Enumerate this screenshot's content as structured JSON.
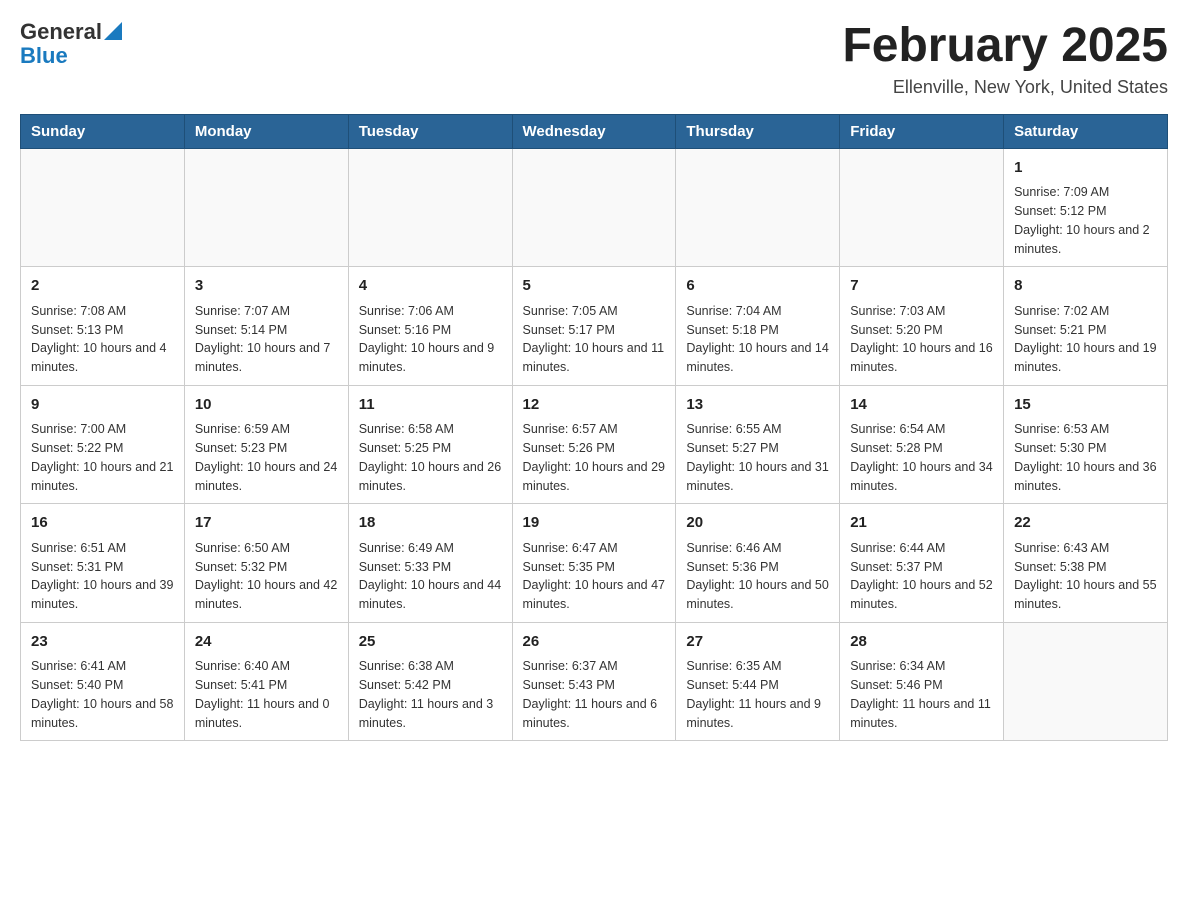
{
  "logo": {
    "general": "General",
    "blue": "Blue"
  },
  "header": {
    "title": "February 2025",
    "location": "Ellenville, New York, United States"
  },
  "weekdays": [
    "Sunday",
    "Monday",
    "Tuesday",
    "Wednesday",
    "Thursday",
    "Friday",
    "Saturday"
  ],
  "weeks": [
    [
      {
        "day": "",
        "sunrise": "",
        "sunset": "",
        "daylight": ""
      },
      {
        "day": "",
        "sunrise": "",
        "sunset": "",
        "daylight": ""
      },
      {
        "day": "",
        "sunrise": "",
        "sunset": "",
        "daylight": ""
      },
      {
        "day": "",
        "sunrise": "",
        "sunset": "",
        "daylight": ""
      },
      {
        "day": "",
        "sunrise": "",
        "sunset": "",
        "daylight": ""
      },
      {
        "day": "",
        "sunrise": "",
        "sunset": "",
        "daylight": ""
      },
      {
        "day": "1",
        "sunrise": "Sunrise: 7:09 AM",
        "sunset": "Sunset: 5:12 PM",
        "daylight": "Daylight: 10 hours and 2 minutes."
      }
    ],
    [
      {
        "day": "2",
        "sunrise": "Sunrise: 7:08 AM",
        "sunset": "Sunset: 5:13 PM",
        "daylight": "Daylight: 10 hours and 4 minutes."
      },
      {
        "day": "3",
        "sunrise": "Sunrise: 7:07 AM",
        "sunset": "Sunset: 5:14 PM",
        "daylight": "Daylight: 10 hours and 7 minutes."
      },
      {
        "day": "4",
        "sunrise": "Sunrise: 7:06 AM",
        "sunset": "Sunset: 5:16 PM",
        "daylight": "Daylight: 10 hours and 9 minutes."
      },
      {
        "day": "5",
        "sunrise": "Sunrise: 7:05 AM",
        "sunset": "Sunset: 5:17 PM",
        "daylight": "Daylight: 10 hours and 11 minutes."
      },
      {
        "day": "6",
        "sunrise": "Sunrise: 7:04 AM",
        "sunset": "Sunset: 5:18 PM",
        "daylight": "Daylight: 10 hours and 14 minutes."
      },
      {
        "day": "7",
        "sunrise": "Sunrise: 7:03 AM",
        "sunset": "Sunset: 5:20 PM",
        "daylight": "Daylight: 10 hours and 16 minutes."
      },
      {
        "day": "8",
        "sunrise": "Sunrise: 7:02 AM",
        "sunset": "Sunset: 5:21 PM",
        "daylight": "Daylight: 10 hours and 19 minutes."
      }
    ],
    [
      {
        "day": "9",
        "sunrise": "Sunrise: 7:00 AM",
        "sunset": "Sunset: 5:22 PM",
        "daylight": "Daylight: 10 hours and 21 minutes."
      },
      {
        "day": "10",
        "sunrise": "Sunrise: 6:59 AM",
        "sunset": "Sunset: 5:23 PM",
        "daylight": "Daylight: 10 hours and 24 minutes."
      },
      {
        "day": "11",
        "sunrise": "Sunrise: 6:58 AM",
        "sunset": "Sunset: 5:25 PM",
        "daylight": "Daylight: 10 hours and 26 minutes."
      },
      {
        "day": "12",
        "sunrise": "Sunrise: 6:57 AM",
        "sunset": "Sunset: 5:26 PM",
        "daylight": "Daylight: 10 hours and 29 minutes."
      },
      {
        "day": "13",
        "sunrise": "Sunrise: 6:55 AM",
        "sunset": "Sunset: 5:27 PM",
        "daylight": "Daylight: 10 hours and 31 minutes."
      },
      {
        "day": "14",
        "sunrise": "Sunrise: 6:54 AM",
        "sunset": "Sunset: 5:28 PM",
        "daylight": "Daylight: 10 hours and 34 minutes."
      },
      {
        "day": "15",
        "sunrise": "Sunrise: 6:53 AM",
        "sunset": "Sunset: 5:30 PM",
        "daylight": "Daylight: 10 hours and 36 minutes."
      }
    ],
    [
      {
        "day": "16",
        "sunrise": "Sunrise: 6:51 AM",
        "sunset": "Sunset: 5:31 PM",
        "daylight": "Daylight: 10 hours and 39 minutes."
      },
      {
        "day": "17",
        "sunrise": "Sunrise: 6:50 AM",
        "sunset": "Sunset: 5:32 PM",
        "daylight": "Daylight: 10 hours and 42 minutes."
      },
      {
        "day": "18",
        "sunrise": "Sunrise: 6:49 AM",
        "sunset": "Sunset: 5:33 PM",
        "daylight": "Daylight: 10 hours and 44 minutes."
      },
      {
        "day": "19",
        "sunrise": "Sunrise: 6:47 AM",
        "sunset": "Sunset: 5:35 PM",
        "daylight": "Daylight: 10 hours and 47 minutes."
      },
      {
        "day": "20",
        "sunrise": "Sunrise: 6:46 AM",
        "sunset": "Sunset: 5:36 PM",
        "daylight": "Daylight: 10 hours and 50 minutes."
      },
      {
        "day": "21",
        "sunrise": "Sunrise: 6:44 AM",
        "sunset": "Sunset: 5:37 PM",
        "daylight": "Daylight: 10 hours and 52 minutes."
      },
      {
        "day": "22",
        "sunrise": "Sunrise: 6:43 AM",
        "sunset": "Sunset: 5:38 PM",
        "daylight": "Daylight: 10 hours and 55 minutes."
      }
    ],
    [
      {
        "day": "23",
        "sunrise": "Sunrise: 6:41 AM",
        "sunset": "Sunset: 5:40 PM",
        "daylight": "Daylight: 10 hours and 58 minutes."
      },
      {
        "day": "24",
        "sunrise": "Sunrise: 6:40 AM",
        "sunset": "Sunset: 5:41 PM",
        "daylight": "Daylight: 11 hours and 0 minutes."
      },
      {
        "day": "25",
        "sunrise": "Sunrise: 6:38 AM",
        "sunset": "Sunset: 5:42 PM",
        "daylight": "Daylight: 11 hours and 3 minutes."
      },
      {
        "day": "26",
        "sunrise": "Sunrise: 6:37 AM",
        "sunset": "Sunset: 5:43 PM",
        "daylight": "Daylight: 11 hours and 6 minutes."
      },
      {
        "day": "27",
        "sunrise": "Sunrise: 6:35 AM",
        "sunset": "Sunset: 5:44 PM",
        "daylight": "Daylight: 11 hours and 9 minutes."
      },
      {
        "day": "28",
        "sunrise": "Sunrise: 6:34 AM",
        "sunset": "Sunset: 5:46 PM",
        "daylight": "Daylight: 11 hours and 11 minutes."
      },
      {
        "day": "",
        "sunrise": "",
        "sunset": "",
        "daylight": ""
      }
    ]
  ]
}
